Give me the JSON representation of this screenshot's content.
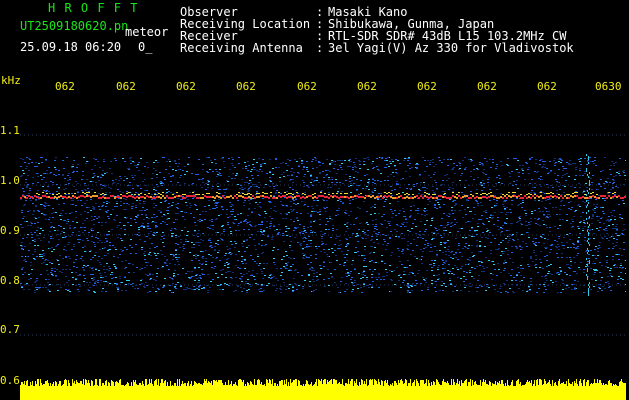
{
  "header": {
    "brand": "H R O F F T",
    "filename": "UT2509180620.pn",
    "meteor": "meteor",
    "datetime": "25.09.18 06:20",
    "extra": "0_",
    "fields": [
      {
        "label": "Observer",
        "value": "Masaki Kano"
      },
      {
        "label": "Receiving Location",
        "value": "Shibukawa, Gunma, Japan"
      },
      {
        "label": "Receiver",
        "value": "RTL-SDR SDR# 43dB L15 103.2MHz CW"
      },
      {
        "label": "Receiving Antenna",
        "value": "3el Yagi(V) Az 330 for Vladivostok"
      }
    ]
  },
  "axes": {
    "unit": "kHz",
    "time_ticks": [
      "062",
      "062",
      "062",
      "062",
      "062",
      "062",
      "062",
      "062",
      "062",
      "0630"
    ],
    "freq_ticks": [
      "1.1",
      "1.0",
      "0.9",
      "0.8",
      "0.7",
      "0.6"
    ]
  },
  "colors": {
    "background": "#000000",
    "text": "#ffffff",
    "header_green": "#19e619",
    "axis_yellow": "#f2ef1a",
    "signal_red": "#e8233a",
    "noise_blue": "#1f5fe0",
    "noise_cyan": "#35c9e8",
    "level_yellow": "#ffff00"
  }
}
